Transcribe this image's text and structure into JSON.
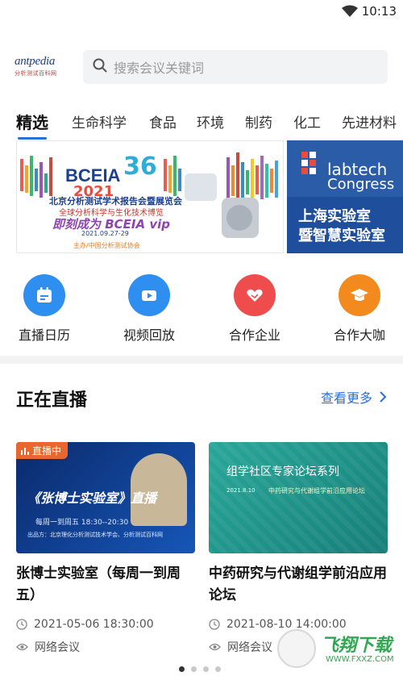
{
  "status_bar": {
    "time": "10:13"
  },
  "header": {
    "logo_text": "antpedia",
    "logo_sub": "分析测试百科网",
    "search_placeholder": "搜索会议关键词"
  },
  "tabs": [
    {
      "label": "精选",
      "active": true
    },
    {
      "label": "生命科学",
      "active": false
    },
    {
      "label": "食品",
      "active": false
    },
    {
      "label": "环境",
      "active": false
    },
    {
      "label": "制药",
      "active": false
    },
    {
      "label": "化工",
      "active": false
    },
    {
      "label": "先进材料",
      "active": false
    }
  ],
  "banners": {
    "banner1": {
      "title": "BCEIA",
      "year": "2021",
      "anniv": "36",
      "line1": "北京分析测试学术报告会暨展览会",
      "line2": "全球分析科学与生化技术博览",
      "line3": "即刻成为 BCEIA vip",
      "date": "2021.09.27-29",
      "org": "主办/中国分析测试协会"
    },
    "banner2": {
      "line1": "labtech",
      "line2": "Congress",
      "line3": "上海实验室",
      "line4": "暨智慧实验室"
    }
  },
  "features": [
    {
      "label": "直播日历",
      "color": "#2f8ff0",
      "icon": "calendar-icon"
    },
    {
      "label": "视频回放",
      "color": "#2f8ff0",
      "icon": "video-icon"
    },
    {
      "label": "合作企业",
      "color": "#ef4d4d",
      "icon": "handshake-icon"
    },
    {
      "label": "合作大咖",
      "color": "#f28a1e",
      "icon": "graduation-cap-icon"
    }
  ],
  "live_section": {
    "title": "正在直播",
    "more": "查看更多"
  },
  "cards": [
    {
      "badge": "直播中",
      "thumb_title": "《张博士实验室》直播",
      "thumb_time": "每周一到周五  18:30--20:30",
      "thumb_org": "出品方：北京理化分析测试技术学会、分析测试百科网",
      "title": "张博士实验室（每周一到周五）",
      "datetime": "2021-05-06 18:30:00",
      "type": "网络会议"
    },
    {
      "thumb_title": "组学社区专家论坛系列",
      "thumb_sub": "中药研究与代谢组学前沿应用论坛",
      "thumb_date": "2021.8.10",
      "title": "中药研究与代谢组学前沿应用论坛",
      "datetime": "2021-08-10 14:00:00",
      "type": "网络会议"
    }
  ],
  "watermark": {
    "text": "飞翔下载",
    "url": "WWW.FXXZ.COM"
  },
  "colors": {
    "accent": "#2a6fdb",
    "live": "#e8672f"
  }
}
